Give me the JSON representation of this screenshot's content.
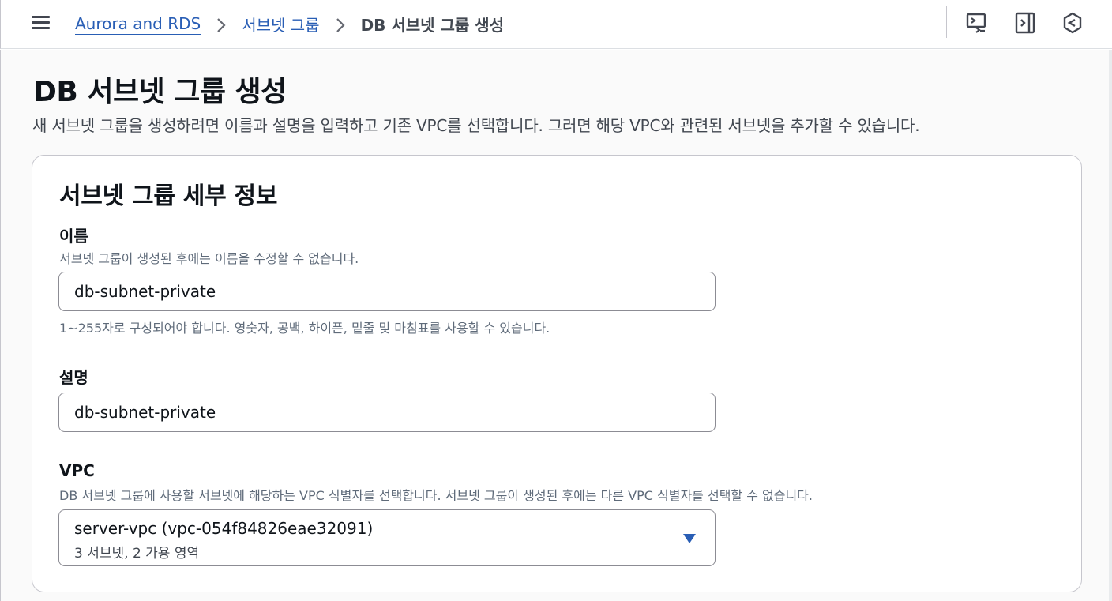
{
  "breadcrumb": {
    "items": [
      "Aurora and RDS",
      "서브넷 그룹"
    ],
    "current": "DB 서브넷 그룹 생성"
  },
  "icons": {
    "menu": "hamburger-menu-icon",
    "top_right": [
      "cloudshell-icon",
      "panel-toggle-icon",
      "feedback-hex-icon"
    ]
  },
  "page": {
    "title": "DB 서브넷 그룹 생성",
    "description": "새 서브넷 그룹을 생성하려면 이름과 설명을 입력하고 기존 VPC를 선택합니다. 그러면 해당 VPC와 관련된 서브넷을 추가할 수 있습니다."
  },
  "details": {
    "title": "서브넷 그룹 세부 정보",
    "name": {
      "label": "이름",
      "description": "서브넷 그룹이 생성된 후에는 이름을 수정할 수 없습니다.",
      "value": "db-subnet-private",
      "constraint": "1~255자로 구성되어야 합니다. 영숫자, 공백, 하이픈, 밑줄 및 마침표를 사용할 수 있습니다."
    },
    "desc": {
      "label": "설명",
      "value": "db-subnet-private"
    },
    "vpc": {
      "label": "VPC",
      "description": "DB 서브넷 그룹에 사용할 서브넷에 해당하는 VPC 식별자를 선택합니다. 서브넷 그룹이 생성된 후에는 다른 VPC 식별자를 선택할 수 없습니다.",
      "selected": "server-vpc (vpc-054f84826eae32091)",
      "selected_detail": "3 서브넷, 2 가용 영역"
    }
  },
  "colors": {
    "link": "#295eb5",
    "caret": "#295eb5",
    "border": "#8c8c94",
    "background": "#fafafa"
  }
}
